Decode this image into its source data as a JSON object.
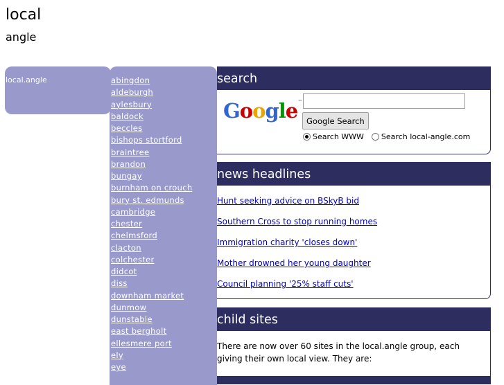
{
  "header": {
    "title": "local",
    "subtitle": "angle"
  },
  "brand": {
    "label": "local.angle"
  },
  "towns": [
    "abingdon",
    "aldeburgh",
    "aylesbury",
    "baldock",
    "beccles",
    "bishops stortford",
    "braintree",
    "brandon",
    "bungay",
    "burnham on crouch",
    "bury st. edmunds",
    "cambridge",
    "chester",
    "chelmsford",
    "clacton",
    "colchester",
    "didcot",
    "diss",
    "downham market",
    "dunmow",
    "dunstable",
    "east bergholt",
    "ellesmere port",
    "ely",
    "eye"
  ],
  "search": {
    "heading": "search",
    "logo_text": "Google",
    "input_value": "",
    "button_label": "Google Search",
    "option_www": "Search WWW",
    "option_site": "Search local-angle.com",
    "selected": "www"
  },
  "news": {
    "heading": "news headlines",
    "items": [
      "Hunt seeking advice on BSkyB bid",
      "Southern Cross to stop running homes",
      "Immigration charity 'closes down'",
      "Mother drowned her young daughter",
      "Council planning '25% staff cuts'"
    ]
  },
  "child_sites": {
    "heading": "child sites",
    "text": "There are now over 60 sites in the local.angle group, each giving their own local view. They are:"
  },
  "colors": {
    "nav_bg": "#9999cc",
    "header_bg": "#2d2d5f",
    "link": "#0000cc"
  }
}
